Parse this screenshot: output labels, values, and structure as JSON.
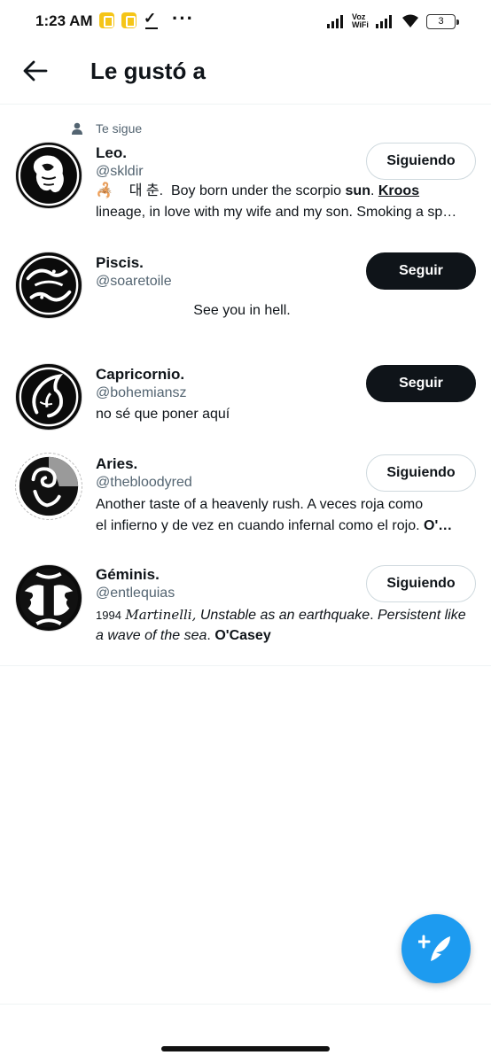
{
  "status_bar": {
    "time": "1:23 AM",
    "network_label_1": "Voz",
    "network_label_2": "WiFi",
    "battery": "3",
    "icons": [
      "notification-icon",
      "notification-icon",
      "check-icon",
      "more-dots-icon",
      "signal-icon",
      "signal-icon",
      "wifi-icon",
      "battery-icon"
    ]
  },
  "header": {
    "title": "Le gustó a",
    "back_icon": "arrow-left-icon"
  },
  "users": [
    {
      "social_context": "Te sigue",
      "name": "Leo.",
      "handle": "@skldir",
      "bio_parts": [
        "🦂",
        "대 춘.",
        "Boy born under the scorpio",
        "sun",
        ".",
        "Kroos",
        "lineage, in love with my wife and my son. Smoking a sp…"
      ],
      "button": "Siguiendo",
      "following": true
    },
    {
      "name": "Piscis.",
      "handle": "@soaretoile",
      "bio": "See you in hell.",
      "button": "Seguir",
      "following": false
    },
    {
      "name": "Capricornio.",
      "handle": "@bohemiansz",
      "bio": "no sé que poner aquí",
      "button": "Seguir",
      "following": false
    },
    {
      "name": "Aries.",
      "handle": "@thebloodyred",
      "bio_line1": "Another taste of a heavenly rush. A veces roja como",
      "bio_line2_parts": [
        "el infierno y de vez en cuando infernal como el rojo.",
        "O'…"
      ],
      "button": "Siguiendo",
      "following": true
    },
    {
      "name": "Géminis.",
      "handle": "@entlequias",
      "bio_line1_parts": [
        "1994",
        "Martinelli",
        ",",
        "Unstable as an earthquake",
        ".",
        "Persistent like"
      ],
      "bio_line2_parts": [
        "a wave of the sea",
        ".",
        "O'Casey"
      ],
      "button": "Siguiendo",
      "following": true
    }
  ],
  "fab": {
    "icon": "compose-tweet-icon"
  },
  "colors": {
    "accent": "#1d9bf0",
    "text_primary": "#0f1419",
    "text_secondary": "#536471",
    "divider": "#eff3f4"
  }
}
